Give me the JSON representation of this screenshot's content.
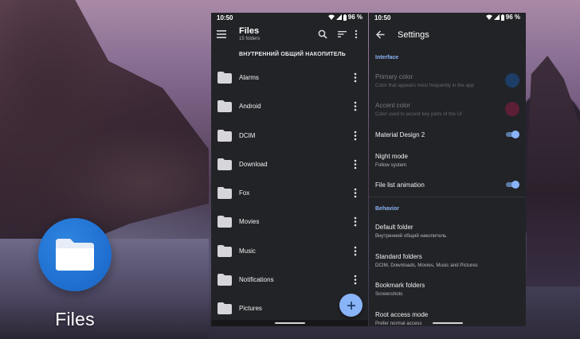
{
  "launcher": {
    "app_label": "Files",
    "icon": "folder-icon",
    "icon_color": "#1f6fd0"
  },
  "files_screen": {
    "status": {
      "time": "10:50",
      "battery": "96 %"
    },
    "toolbar": {
      "title": "Files",
      "subtitle": "15 folders",
      "icons": [
        "menu-icon",
        "search-icon",
        "sort-icon",
        "more-vert-icon"
      ]
    },
    "location": "ВНУТРЕННИЙ ОБЩИЙ НАКОПИТЕЛЬ",
    "folders": [
      {
        "name": "Alarms"
      },
      {
        "name": "Android"
      },
      {
        "name": "DCIM"
      },
      {
        "name": "Download"
      },
      {
        "name": "Fox"
      },
      {
        "name": "Movies"
      },
      {
        "name": "Music"
      },
      {
        "name": "Notifications"
      },
      {
        "name": "Pictures"
      }
    ],
    "fab_label": "+"
  },
  "settings_screen": {
    "status": {
      "time": "10:50",
      "battery": "96 %"
    },
    "title": "Settings",
    "sections": {
      "interface": "Interface",
      "behavior": "Behavior"
    },
    "prefs": {
      "primary_color": {
        "title": "Primary color",
        "summary": "Color that appears most frequently in the app",
        "color": "#1c3d66"
      },
      "accent_color": {
        "title": "Accent color",
        "summary": "Color used to accent key parts of the UI",
        "color": "#5b1f36"
      },
      "material_design_2": {
        "title": "Material Design 2",
        "enabled": true
      },
      "night_mode": {
        "title": "Night mode",
        "summary": "Follow system"
      },
      "file_list_animation": {
        "title": "File list animation",
        "enabled": true
      },
      "default_folder": {
        "title": "Default folder",
        "summary": "Внутренний общий накопитель"
      },
      "standard_folders": {
        "title": "Standard folders",
        "summary": "DCIM, Downloads, Movies, Music and Pictures"
      },
      "bookmark_folders": {
        "title": "Bookmark folders",
        "summary": "Screenshots"
      },
      "root_access_mode": {
        "title": "Root access mode",
        "summary": "Prefer normal access"
      }
    }
  },
  "colors": {
    "surface": "#222326",
    "accent": "#8ab4f8",
    "text_primary": "#f1f1f3",
    "text_secondary": "#b9b9bd"
  }
}
